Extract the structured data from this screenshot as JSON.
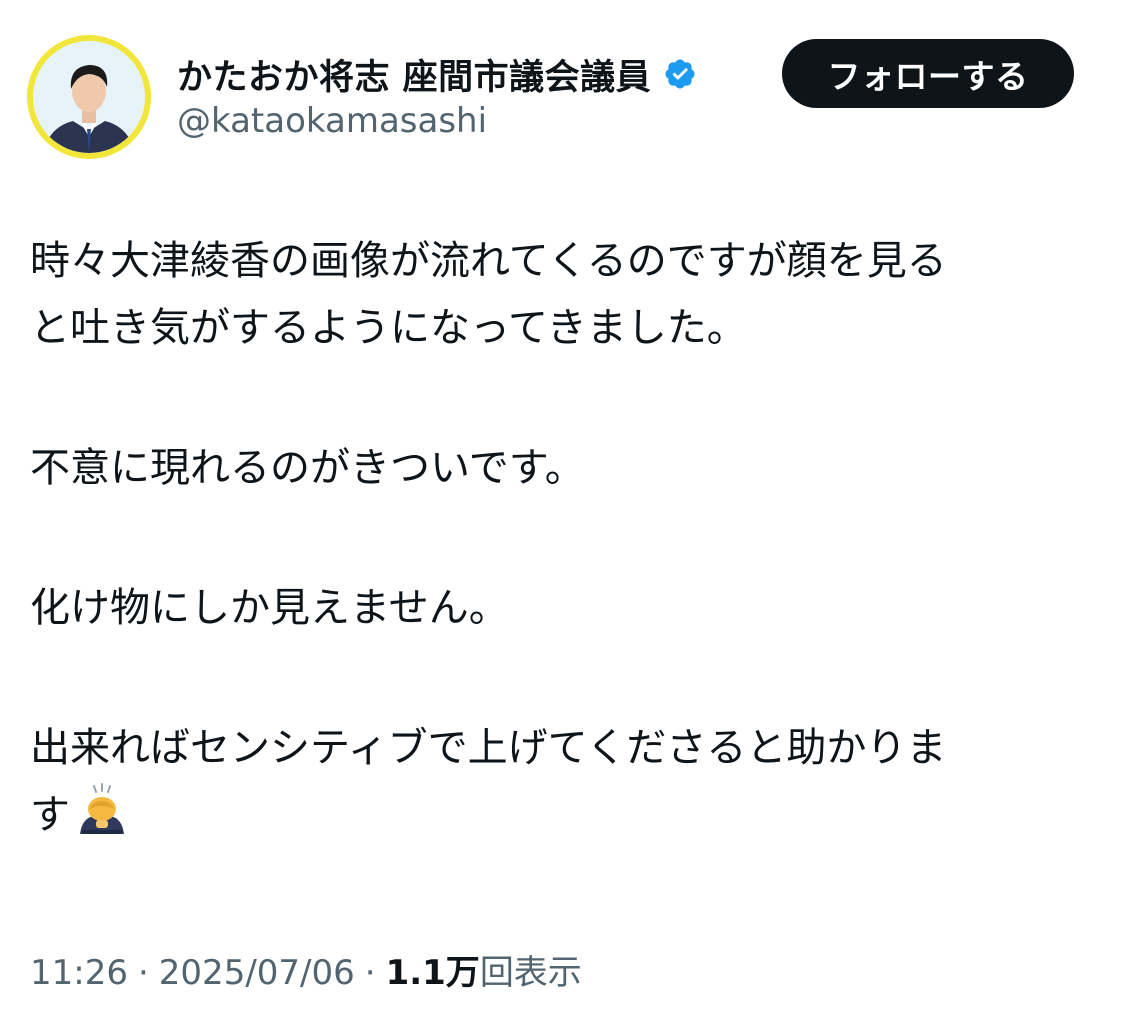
{
  "author": {
    "display_name": "かたおか将志 座間市議会議員",
    "handle": "@kataokamasashi",
    "verified": true,
    "verified_color": "#1d9bf0",
    "avatar_ring_color": "#f2e63a"
  },
  "follow_button": {
    "label": "フォローする",
    "bg_color": "#0f1419",
    "text_color": "#ffffff"
  },
  "tweet": {
    "paragraphs": [
      [
        "時々大津綾香の画像が流れてくるのですが顔を見る",
        "と吐き気がするようになってきました。"
      ],
      [
        "不意に現れるのがきついです。"
      ],
      [
        "化け物にしか見えません。"
      ],
      [
        "出来ればセンシティブで上げてくださると助かりま",
        "す"
      ]
    ],
    "trailing_emoji": "person-bowing-emoji"
  },
  "meta": {
    "time": "11:26",
    "date": "2025/07/06",
    "views_count": "1.1万",
    "views_label": "回表示",
    "separator": "·"
  }
}
